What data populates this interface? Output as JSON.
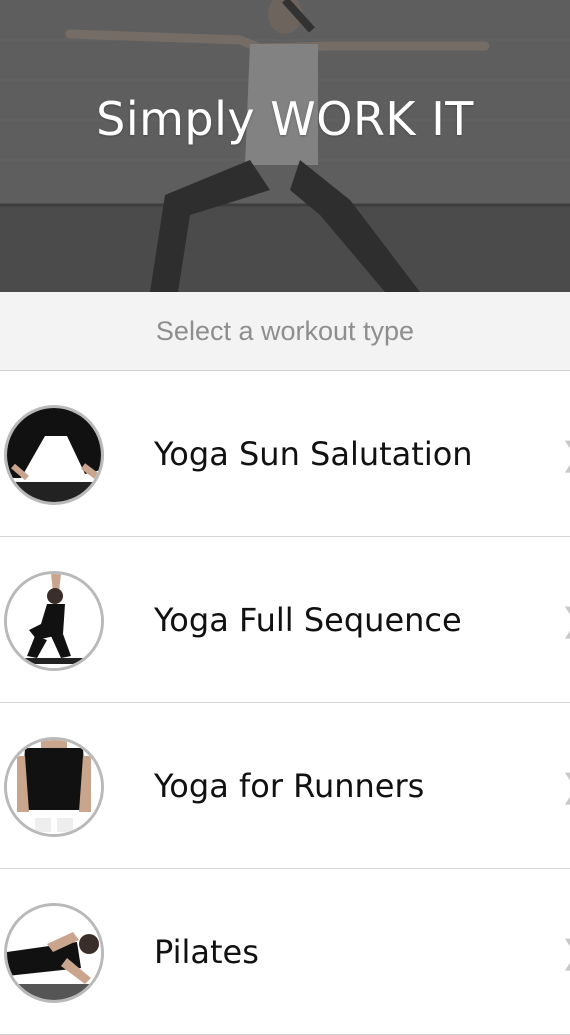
{
  "app": {
    "title": "Simply WORK IT"
  },
  "section": {
    "header": "Select a workout type"
  },
  "workouts": [
    {
      "label": "Yoga Sun Salutation",
      "thumb_icon": "downward-dog-pose-icon"
    },
    {
      "label": "Yoga Full Sequence",
      "thumb_icon": "chair-pose-icon"
    },
    {
      "label": "Yoga for Runners",
      "thumb_icon": "seated-runner-icon"
    },
    {
      "label": "Pilates",
      "thumb_icon": "pilates-side-lying-icon"
    }
  ],
  "colors": {
    "hero_overlay": "#5f5f5f",
    "header_bg": "#f3f3f3",
    "header_text": "#8e8e8e",
    "label_text": "#111111",
    "thumb_border": "#b9b9b9",
    "chevron": "#c8c8c8"
  },
  "chevron_glyph": "❯"
}
